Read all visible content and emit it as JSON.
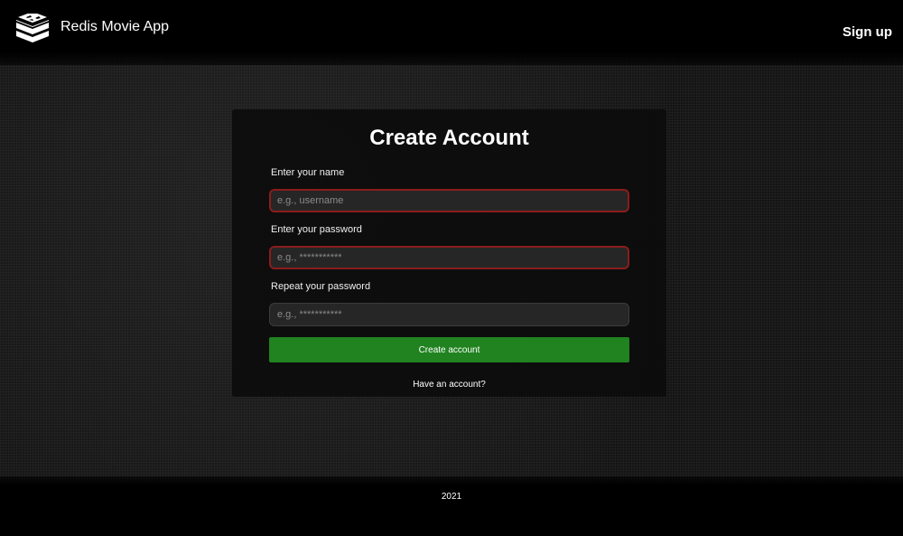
{
  "header": {
    "brand_title": "Redis Movie App",
    "logo_icon": "redis-stack-icon",
    "signup_label": "Sign up"
  },
  "form": {
    "title": "Create Account",
    "name_label": "Enter your name",
    "name_placeholder": "e.g., username",
    "password_label": "Enter your password",
    "password_placeholder": "e.g., ***********",
    "repeat_label": "Repeat your password",
    "repeat_placeholder": "e.g., ***********",
    "submit_label": "Create account",
    "have_account_label": "Have an account?"
  },
  "footer": {
    "text": "2021"
  },
  "colors": {
    "submit_button": "#208320",
    "invalid_border": "#8c1c1c",
    "background": "#141414"
  }
}
